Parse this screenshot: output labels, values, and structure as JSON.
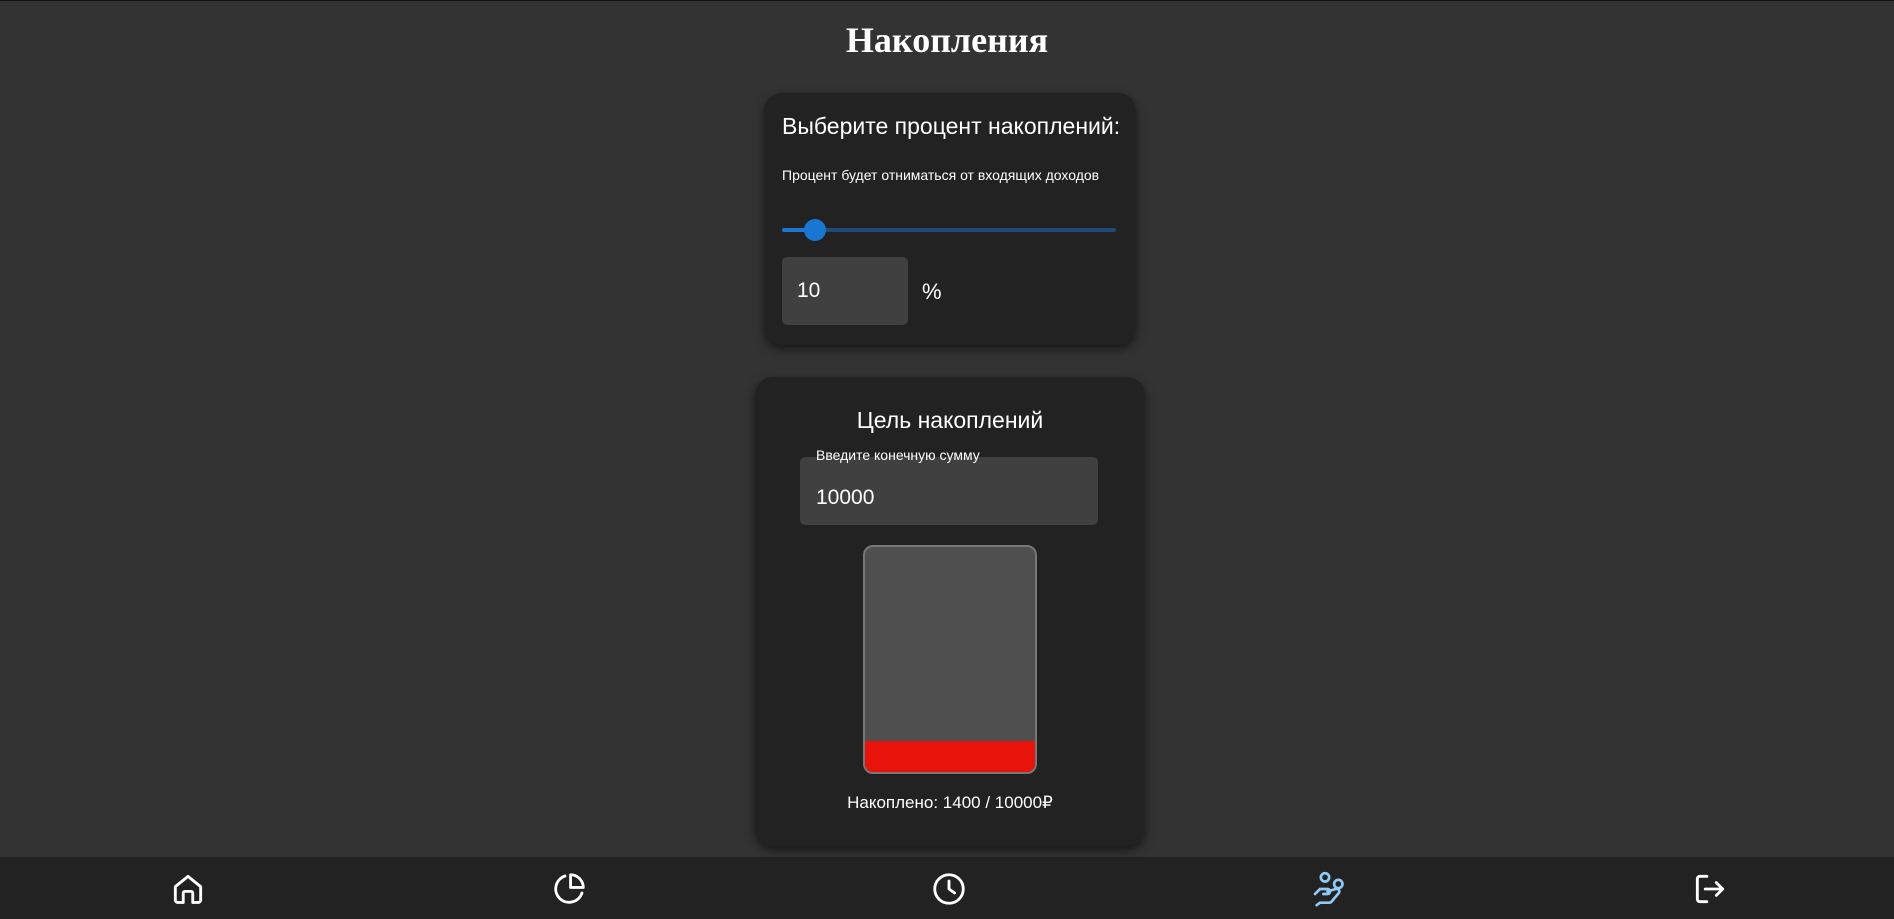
{
  "page": {
    "title": "Накопления"
  },
  "savings_percent": {
    "heading": "Выберите процент накоплений:",
    "hint": "Процент будет отниматься от входящих доходов",
    "slider_value": 10,
    "input_value": "10",
    "unit": "%"
  },
  "savings_goal": {
    "heading": "Цель накоплений",
    "field_label": "Введите конечную сумму",
    "field_value": "10000",
    "progress_fraction": 0.14,
    "saved_text": "Накоплено: 1400 / 10000₽",
    "colors": {
      "fill": "#e8130a",
      "jar": "#4f4f4f"
    }
  },
  "navbar": {
    "items": [
      {
        "icon": "home-icon",
        "active": false
      },
      {
        "icon": "pie-chart-icon",
        "active": false
      },
      {
        "icon": "clock-icon",
        "active": false
      },
      {
        "icon": "savings-hand-icon",
        "active": true
      },
      {
        "icon": "logout-icon",
        "active": false
      }
    ],
    "colors": {
      "icon": "#ffffff",
      "active_icon": "#90caf9"
    }
  }
}
